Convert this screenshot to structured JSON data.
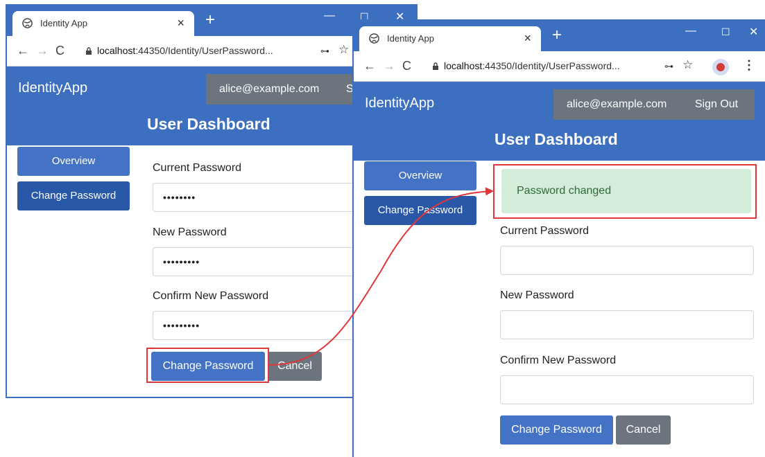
{
  "left_window": {
    "tab_title": "Identity App",
    "tab_close": "×",
    "new_tab": "+",
    "url_host": "localhost",
    "url_rest": ":44350/Identity/UserPassword...",
    "brand": "IdentityApp",
    "user_email": "alice@example.com",
    "sign_out_partial": "S",
    "page_title": "User Dashboard",
    "sidebar": {
      "overview": "Overview",
      "change_password": "Change Password"
    },
    "form": {
      "current_password_label": "Current Password",
      "current_password_value": "••••••••",
      "new_password_label": "New Password",
      "new_password_value": "•••••••••",
      "confirm_password_label": "Confirm New Password",
      "confirm_password_value": "•••••••••",
      "submit": "Change Password",
      "cancel": "Cancel"
    }
  },
  "right_window": {
    "tab_title": "Identity App",
    "tab_close": "×",
    "new_tab": "+",
    "url_host": "localhost",
    "url_rest": ":44350/Identity/UserPassword...",
    "brand": "IdentityApp",
    "user_email": "alice@example.com",
    "sign_out": "Sign Out",
    "page_title": "User Dashboard",
    "alert": "Password changed",
    "sidebar": {
      "overview": "Overview",
      "change_password": "Change Password"
    },
    "form": {
      "current_password_label": "Current Password",
      "current_password_value": "",
      "new_password_label": "New Password",
      "new_password_value": "",
      "confirm_password_label": "Confirm New Password",
      "confirm_password_value": "",
      "submit": "Change Password",
      "cancel": "Cancel"
    }
  },
  "icons": {
    "back": "←",
    "forward": "→",
    "reload": "C",
    "key": "⊶",
    "star": "☆",
    "menu": "⋮",
    "minimize": "—",
    "maximize": "☐",
    "close": "✕"
  },
  "colors": {
    "brand_blue": "#3d6fc0",
    "primary_button": "#4472c4",
    "active_nav": "#2a58a8",
    "secondary_button": "#6c757d",
    "alert_bg": "#d4edda",
    "alert_text": "#2e6b3a",
    "highlight_red": "#e0373a"
  }
}
